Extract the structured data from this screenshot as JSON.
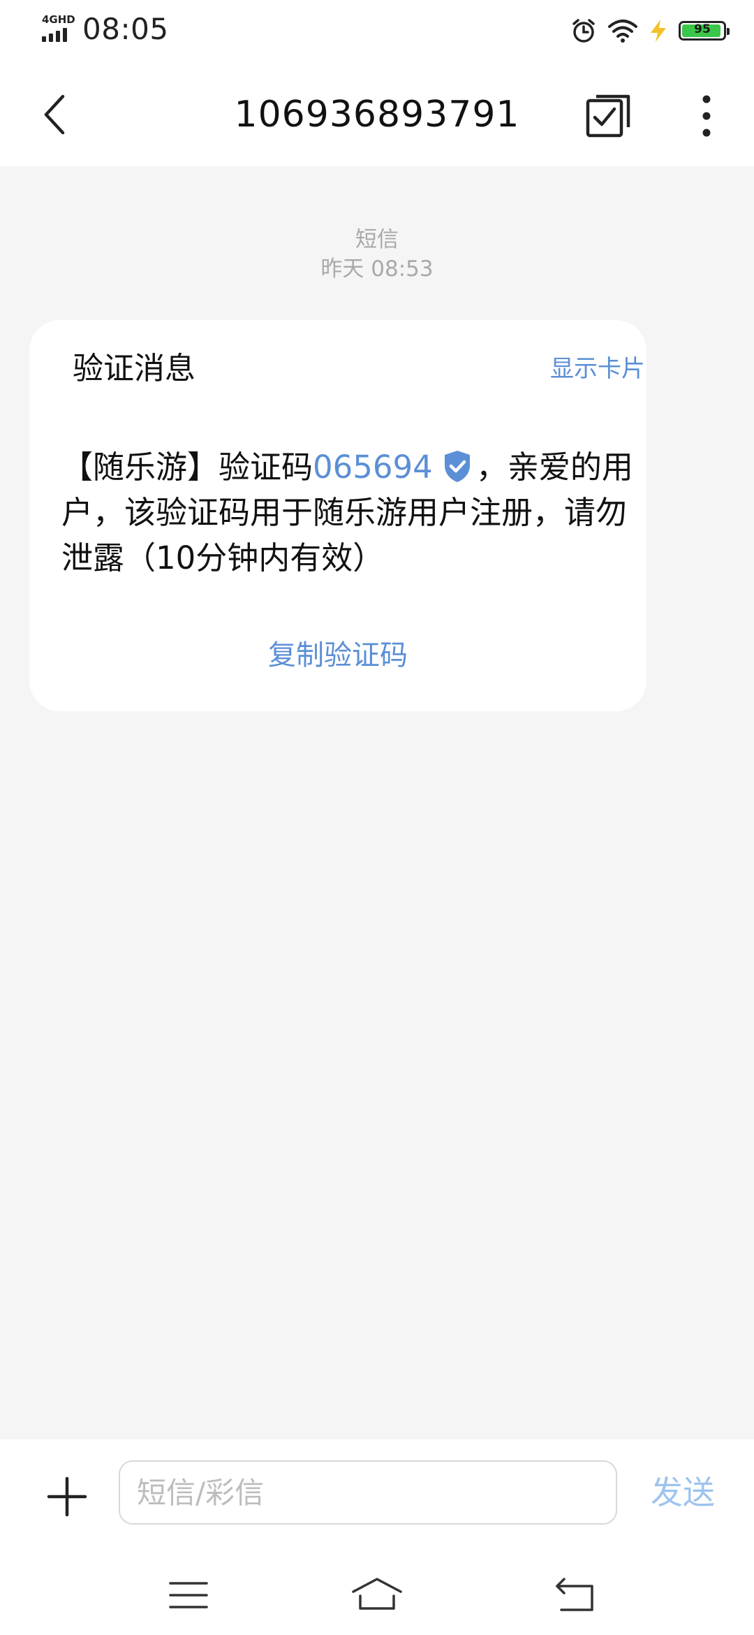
{
  "status_bar": {
    "network": "4GHD",
    "time": "08:05",
    "battery_percent": "95",
    "battery_level": 0.95,
    "battery_color": "#3bc74a",
    "icons": [
      "alarm-icon",
      "wifi-icon",
      "charging-icon",
      "battery-icon"
    ]
  },
  "header": {
    "title": "106936893791",
    "back_icon": "back-arrow-icon",
    "action_icon": "check-square-icon",
    "more_icon": "more-vertical-icon"
  },
  "conversation": {
    "message_type": "短信",
    "timestamp": "昨天 08:53"
  },
  "card": {
    "title": "验证消息",
    "show_card_label": "显示卡片",
    "message_prefix": "【随乐游】验证码",
    "code": "065694",
    "message_suffix": "，亲爱的用户，该验证码用于随乐游用户注册，请勿泄露（10分钟内有效）",
    "copy_label": "复制验证码",
    "verified_icon": "verified-shield-icon",
    "accent_color": "#5b8fd6"
  },
  "composer": {
    "add_icon": "plus-icon",
    "placeholder": "短信/彩信",
    "value": "",
    "send_label": "发送",
    "send_color": "#9ec3ee"
  },
  "nav": {
    "icons": [
      "menu-icon",
      "home-icon",
      "back-icon"
    ]
  }
}
